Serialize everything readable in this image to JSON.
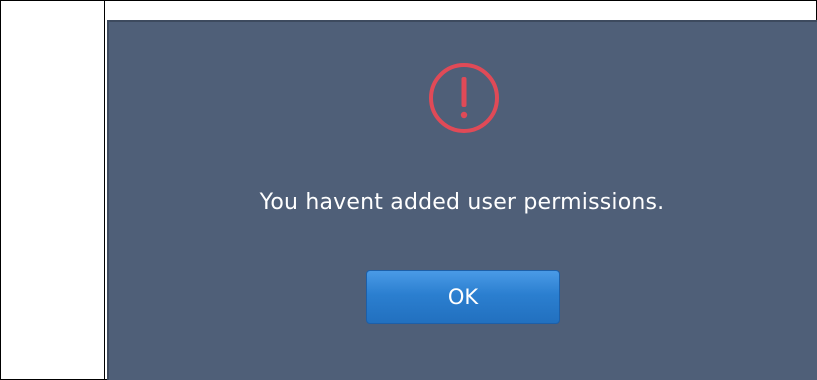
{
  "dialog": {
    "icon": "warning-exclamation-icon",
    "icon_color": "#e04a57",
    "background_color": "#4f5f78",
    "message": "You havent added user permissions.",
    "ok_label": "OK",
    "button_color": "#2b7fd0"
  }
}
